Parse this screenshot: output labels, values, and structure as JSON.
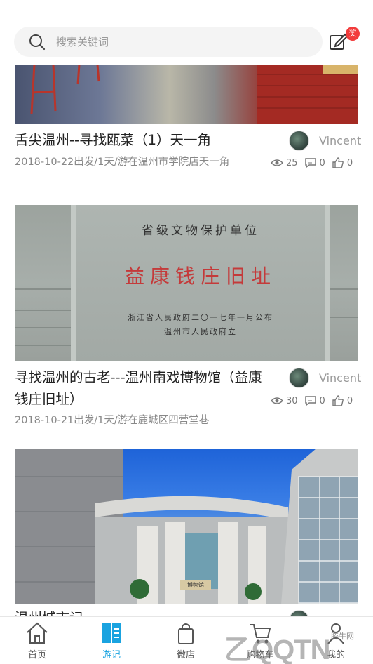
{
  "search": {
    "placeholder": "搜索关键词"
  },
  "header": {
    "badge": "奖"
  },
  "posts": [
    {
      "title": "舌尖温州--寻找瓯菜（1）天一角",
      "meta": "2018-10-22出发/1天/游在温州市学院店天一角",
      "author": "Vincent",
      "views": "25",
      "comments": "0",
      "likes": "0"
    },
    {
      "title": "寻找温州的古老---温州南戏博物馆（益康钱庄旧址）",
      "meta": "2018-10-21出发/1天/游在鹿城区四营堂巷",
      "author": "Vincent",
      "views": "30",
      "comments": "0",
      "likes": "0",
      "image_text": {
        "top": "省级文物保护单位",
        "main": "益康钱庄旧址",
        "bottom1": "浙江省人民政府二〇一七年一月公布",
        "bottom2": "温州市人民政府立"
      }
    },
    {
      "title": "温州城市记",
      "author": "",
      "image_text": {
        "sign": "博物馆"
      }
    }
  ],
  "nav": [
    {
      "label": "首页",
      "icon": "home-icon"
    },
    {
      "label": "游记",
      "icon": "book-icon",
      "active": true
    },
    {
      "label": "微店",
      "icon": "bag-icon"
    },
    {
      "label": "购物车",
      "icon": "cart-icon"
    },
    {
      "label": "我的",
      "icon": "person-icon"
    }
  ],
  "watermark": {
    "logo": "QQTN",
    "sub": "腾牛网",
    "prefix": "乙"
  },
  "colors": {
    "accent": "#1aa3e0",
    "badge": "#f23b3b"
  }
}
